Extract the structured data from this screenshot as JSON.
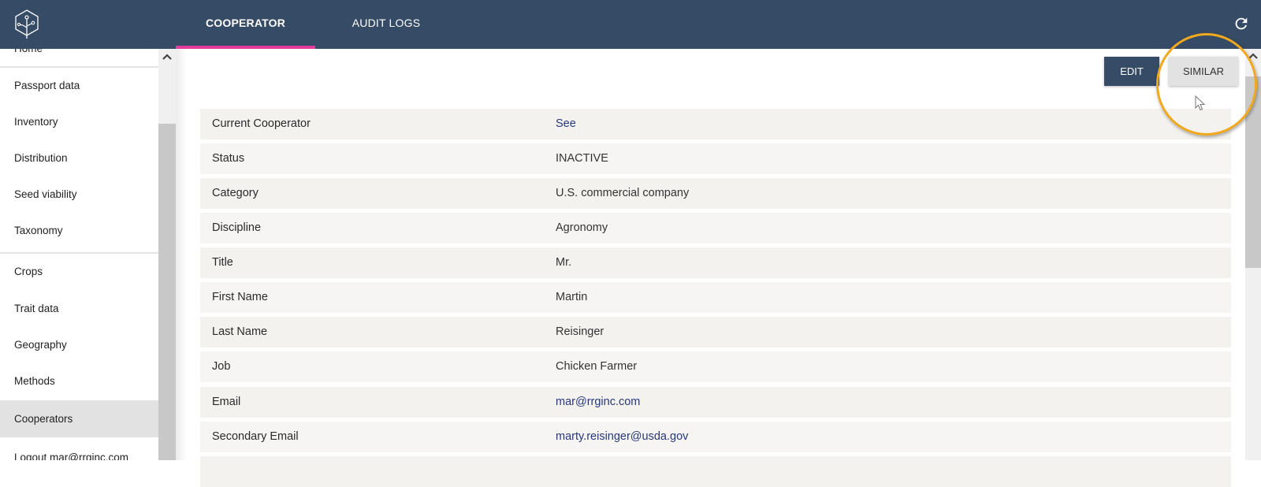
{
  "header": {
    "logo": "tree-hexagon-logo",
    "tabs": [
      {
        "label": "COOPERATOR",
        "active": true
      },
      {
        "label": "AUDIT LOGS",
        "active": false
      }
    ],
    "refresh_icon": "refresh-icon",
    "accent_color": "#e63b9e",
    "bar_color": "#364c66"
  },
  "sidebar": {
    "items": [
      {
        "label": "Home"
      },
      {
        "label": "Passport data"
      },
      {
        "label": "Inventory"
      },
      {
        "label": "Distribution"
      },
      {
        "label": "Seed viability"
      },
      {
        "label": "Taxonomy"
      },
      {
        "label": "Crops"
      },
      {
        "label": "Trait data"
      },
      {
        "label": "Geography"
      },
      {
        "label": "Methods"
      },
      {
        "label": "Cooperators",
        "selected": true
      },
      {
        "label": "Logout mar@rrginc.com"
      }
    ]
  },
  "actions": {
    "edit_label": "EDIT",
    "similar_label": "SIMILAR"
  },
  "details": {
    "rows": [
      {
        "label": "Current Cooperator",
        "value": "See"
      },
      {
        "label": "Status",
        "value": "INACTIVE"
      },
      {
        "label": "Category",
        "value": "U.S. commercial company"
      },
      {
        "label": "Discipline",
        "value": "Agronomy"
      },
      {
        "label": "Title",
        "value": "Mr."
      },
      {
        "label": "First Name",
        "value": "Martin"
      },
      {
        "label": "Last Name",
        "value": "Reisinger"
      },
      {
        "label": "Job",
        "value": "Chicken Farmer"
      },
      {
        "label": "Email",
        "value": "mar@rrginc.com"
      },
      {
        "label": "Secondary Email",
        "value": "marty.reisinger@usda.gov"
      }
    ]
  }
}
